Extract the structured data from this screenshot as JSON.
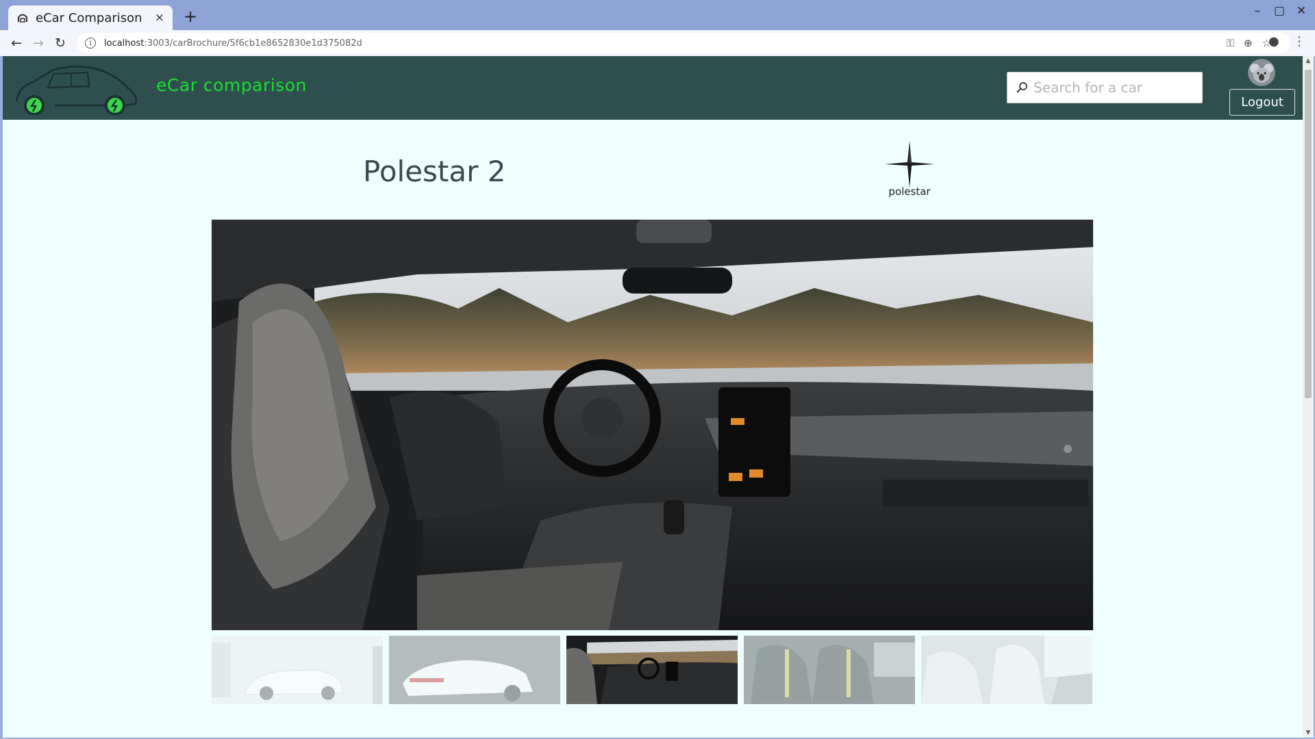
{
  "browser": {
    "tab_title": "eCar Comparison",
    "tab_close": "×",
    "new_tab": "+",
    "url_host": "localhost",
    "url_path": ":3003/carBrochure/5f6cb1e8652830e1d375082d",
    "window_controls": {
      "minimize": "–",
      "maximize": "▢",
      "close": "✕"
    }
  },
  "header": {
    "brand": "eCar comparison",
    "search_placeholder": "Search for a car",
    "logout_label": "Logout",
    "colors": {
      "bar": "#2f4f4f",
      "brand_text": "#19e02e"
    }
  },
  "car": {
    "title": "Polestar 2",
    "brand_logo_text": "polestar"
  },
  "gallery": {
    "selected_index": 2,
    "thumbnails": [
      {
        "label": "exterior-front"
      },
      {
        "label": "exterior-rear"
      },
      {
        "label": "interior-dashboard"
      },
      {
        "label": "interior-seats"
      },
      {
        "label": "interior-cabin"
      }
    ]
  }
}
